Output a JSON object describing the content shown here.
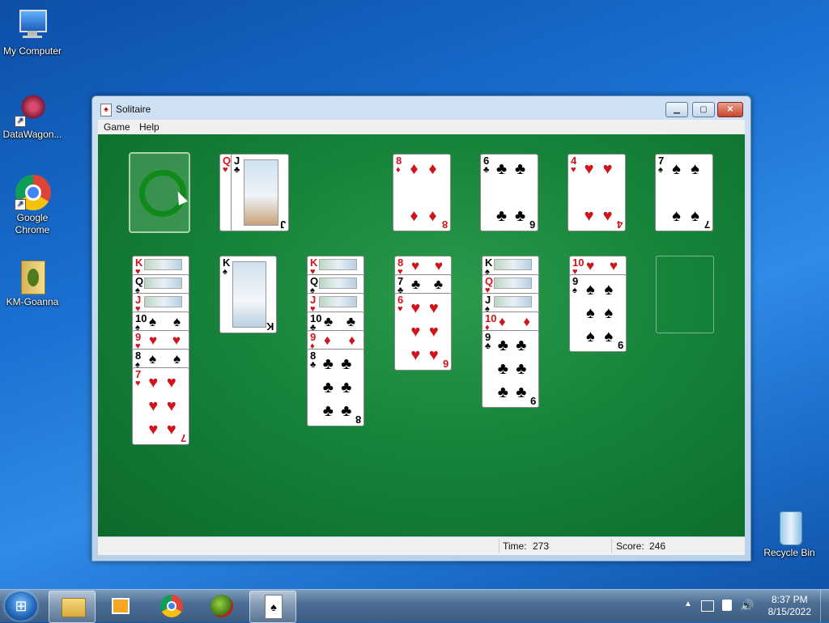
{
  "desktop_icons": [
    {
      "label": "My Computer",
      "icon": "computer-icon"
    },
    {
      "label": "DataWagon...",
      "icon": "datawagon-icon"
    },
    {
      "label": "Google Chrome",
      "icon": "chrome-icon"
    },
    {
      "label": "KM-Goanna",
      "icon": "folder-icon"
    },
    {
      "label": "Recycle Bin",
      "icon": "recycle-bin-icon"
    }
  ],
  "window": {
    "title": "Solitaire",
    "menu": [
      "Game",
      "Help"
    ]
  },
  "status": {
    "time_label": "Time:",
    "time": "273",
    "score_label": "Score:",
    "score": "246"
  },
  "game": {
    "stock": "empty",
    "waste_top": [
      "Q",
      "J"
    ],
    "foundations": [
      {
        "rank": "8",
        "suit": "♦",
        "color": "red"
      },
      {
        "rank": "6",
        "suit": "♣",
        "color": "black"
      },
      {
        "rank": "4",
        "suit": "♥",
        "color": "red"
      },
      {
        "rank": "7",
        "suit": "♠",
        "color": "black"
      }
    ],
    "tableau": [
      [
        {
          "r": "K",
          "s": "♥",
          "c": "red"
        },
        {
          "r": "Q",
          "s": "♠",
          "c": "black"
        },
        {
          "r": "J",
          "s": "♥",
          "c": "red"
        },
        {
          "r": "10",
          "s": "♠",
          "c": "black"
        },
        {
          "r": "9",
          "s": "♥",
          "c": "red"
        },
        {
          "r": "8",
          "s": "♠",
          "c": "black"
        },
        {
          "r": "7",
          "s": "♥",
          "c": "red"
        }
      ],
      [
        {
          "r": "K",
          "s": "♠",
          "c": "black"
        }
      ],
      [
        {
          "r": "K",
          "s": "♥",
          "c": "red"
        },
        {
          "r": "Q",
          "s": "♠",
          "c": "black"
        },
        {
          "r": "J",
          "s": "♥",
          "c": "red"
        },
        {
          "r": "10",
          "s": "♣",
          "c": "black"
        },
        {
          "r": "9",
          "s": "♦",
          "c": "red"
        },
        {
          "r": "8",
          "s": "♣",
          "c": "black"
        }
      ],
      [
        {
          "r": "8",
          "s": "♥",
          "c": "red"
        },
        {
          "r": "7",
          "s": "♣",
          "c": "black"
        },
        {
          "r": "6",
          "s": "♥",
          "c": "red"
        }
      ],
      [
        {
          "r": "K",
          "s": "♠",
          "c": "black"
        },
        {
          "r": "Q",
          "s": "♥",
          "c": "red"
        },
        {
          "r": "J",
          "s": "♠",
          "c": "black"
        },
        {
          "r": "10",
          "s": "♦",
          "c": "red"
        },
        {
          "r": "9",
          "s": "♣",
          "c": "black"
        }
      ],
      [
        {
          "r": "10",
          "s": "♥",
          "c": "red"
        },
        {
          "r": "9",
          "s": "♠",
          "c": "black"
        }
      ],
      []
    ]
  },
  "taskbar": {
    "apps": [
      "explorer-icon",
      "media-player-icon",
      "chrome-icon",
      "goanna-icon",
      "solitaire-icon"
    ],
    "time": "8:37 PM",
    "date": "8/15/2022"
  }
}
